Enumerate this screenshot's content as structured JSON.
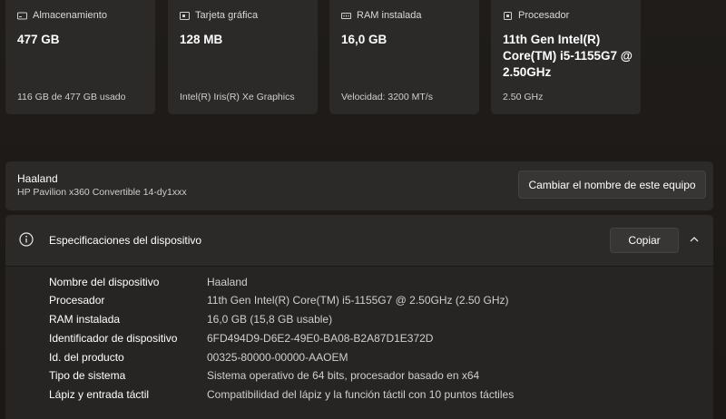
{
  "cards": [
    {
      "title": "Almacenamiento",
      "value": "477 GB",
      "sub": "116 GB de 477 GB usado",
      "icon": "storage-icon"
    },
    {
      "title": "Tarjeta gráfica",
      "value": "128 MB",
      "sub": "Intel(R) Iris(R) Xe Graphics",
      "icon": "gpu-icon"
    },
    {
      "title": "RAM instalada",
      "value": "16,0 GB",
      "sub": "Velocidad: 3200 MT/s",
      "icon": "ram-icon"
    },
    {
      "title": "Procesador",
      "value_lines": [
        "11th Gen Intel(R)",
        "Core(TM) i5-1155G7 @",
        "2.50GHz"
      ],
      "sub": "2.50 GHz",
      "icon": "processor-icon"
    }
  ],
  "device": {
    "name": "Haaland",
    "model": "HP Pavilion x360 Convertible 14-dy1xxx",
    "rename_label": "Cambiar el nombre de este equipo"
  },
  "specs": {
    "title": "Especificaciones del dispositivo",
    "copy_label": "Copiar",
    "rows": [
      {
        "label": "Nombre del dispositivo",
        "value": "Haaland"
      },
      {
        "label": "Procesador",
        "value": "11th Gen Intel(R) Core(TM) i5-1155G7 @ 2.50GHz (2.50 GHz)"
      },
      {
        "label": "RAM instalada",
        "value": "16,0 GB (15,8 GB usable)"
      },
      {
        "label": "Identificador de dispositivo",
        "value": "6FD494D9-D6E2-49E0-BA08-B2A87D1E372D"
      },
      {
        "label": "Id. del producto",
        "value": "00325-80000-00000-AAOEM"
      },
      {
        "label": "Tipo de sistema",
        "value": "Sistema operativo de 64 bits, procesador basado en x64"
      },
      {
        "label": "Lápiz y entrada táctil",
        "value": "Compatibilidad del lápiz y la función táctil con 10 puntos táctiles"
      }
    ]
  },
  "colors": {
    "background": "#1d1a17",
    "card": "#2b2a29",
    "button": "#383634"
  }
}
